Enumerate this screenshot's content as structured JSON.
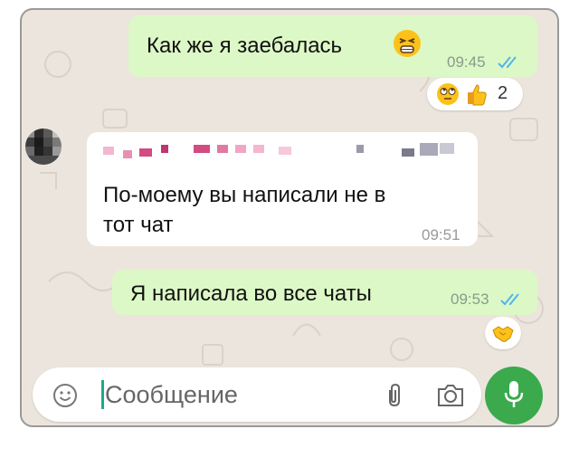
{
  "messages": [
    {
      "direction": "outgoing",
      "text": "Как же я заебалась",
      "emoji": "tired-face-emoji",
      "time": "09:45",
      "status": "read",
      "reactions": {
        "emojis": [
          "face-with-rolling-eyes-emoji",
          "thumbs-up-emoji"
        ],
        "count": "2"
      }
    },
    {
      "direction": "incoming",
      "text_line1": "По-моему вы написали не в",
      "text_line2": "тот чат",
      "time": "09:51"
    },
    {
      "direction": "outgoing",
      "text": "Я написала во все чаты",
      "time": "09:53",
      "status": "read",
      "reactions": {
        "emojis": [
          "handshake-emoji"
        ]
      }
    }
  ],
  "composer": {
    "placeholder": "Сообщение",
    "icons": [
      "smiley-icon",
      "attach-icon",
      "camera-icon",
      "mic-icon"
    ]
  },
  "colors": {
    "chat_background": "#ece5dd",
    "outgoing_bubble": "#dcf8c6",
    "incoming_bubble": "#ffffff",
    "read_ticks": "#4fb6ec",
    "mic_button": "#3aaa4d"
  }
}
